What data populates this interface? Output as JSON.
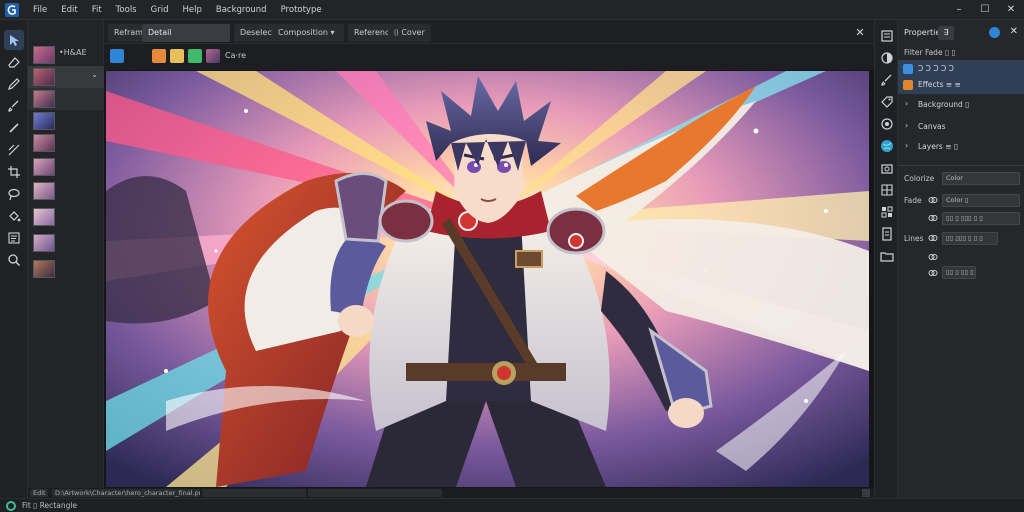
{
  "app": {
    "menu": [
      "File",
      "Edit",
      "Fit",
      "Tools",
      "Grid",
      "Help",
      "Background",
      "Prototype"
    ],
    "window_controls": [
      "–",
      "☐",
      "✕"
    ]
  },
  "left_tools": [
    "select-icon",
    "eraser-icon",
    "pen-icon",
    "brush-icon",
    "pencil-icon",
    "line-icon",
    "crop-icon",
    "lasso-icon",
    "fill-icon",
    "text-icon",
    "zoom-icon"
  ],
  "thumbnail_panel": {
    "items": [
      {
        "label": "•H&AE",
        "has_dropdown": false
      },
      {
        "label": "",
        "has_dropdown": true
      },
      {
        "label": "",
        "has_dropdown": false
      }
    ]
  },
  "tabs": [
    {
      "label": "Reframe"
    },
    {
      "label": "Detail"
    },
    {
      "label": "Deselect"
    },
    {
      "label": "Composition ▾"
    },
    {
      "label": "Reference"
    },
    {
      "label": "⌷ Cover"
    }
  ],
  "option_bar": {
    "label": "Ca·re"
  },
  "canvas_status": {
    "zoom": "Edit",
    "path": "D:\\Artwork\\Character\\hero_character_final.png",
    "size": ""
  },
  "right_panel": {
    "title": "Properties",
    "tab": "∃",
    "subtitle": "Filter Fade ▯ ▯",
    "layers": [
      {
        "name": "Ↄ Ↄ Ↄ Ↄ Ↄ",
        "color": "#3b8fe0",
        "selected": true
      },
      {
        "name": "Effects ≡ ≡",
        "color": "#e0862b",
        "selected": true
      },
      {
        "name": "Background ▯",
        "color": "",
        "selected": false
      },
      {
        "name": "Canvas",
        "color": "",
        "selected": false
      },
      {
        "name": "Layers ≡ ▯",
        "color": "",
        "selected": false
      }
    ],
    "props": {
      "label1": "Colorize",
      "label2": "Fade",
      "label3": "Lines",
      "field1": "Color",
      "field2": "Color ▯",
      "field3": "▯▯ ▯ ▯▯▯ ▯ ▯",
      "field4": "▯▯ ▯▯▯ ▯ ▯ ▯",
      "field5": "▯▯ ▯ ▯▯ ▯"
    }
  },
  "statusbar": {
    "text": "Fit ▯ Rectangle"
  },
  "colors": {
    "accent": "#2f86d6",
    "status_ok": "#3dbd9a"
  }
}
